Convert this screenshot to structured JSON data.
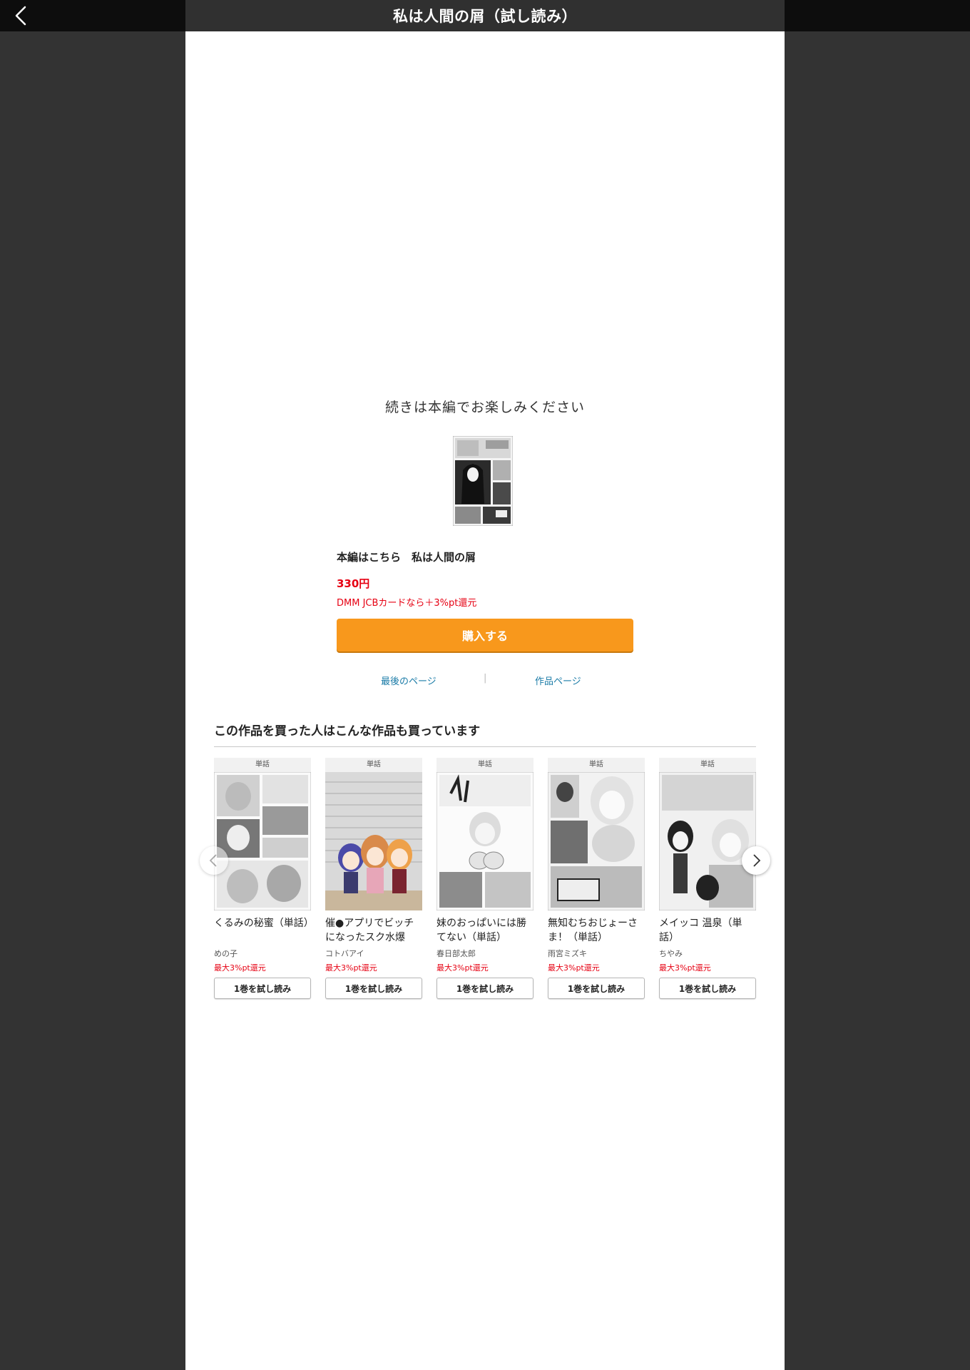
{
  "header": {
    "title": "私は人間の屑（試し読み）",
    "back_icon": "chevron-left-icon"
  },
  "end_screen": {
    "continue_message": "続きは本編でお楽しみください",
    "product_title": "本編はこちら　私は人間の屑",
    "price": "330円",
    "cashback": "DMM JCBカードなら＋3%pt還元",
    "buy_label": "購入する",
    "last_page_link": "最後のページ",
    "work_page_link": "作品ページ",
    "link_separator": "|"
  },
  "recommendations": {
    "heading": "この作品を買った人はこんな作品も買っています",
    "items": [
      {
        "tag": "単話",
        "name": "くるみの秘蜜（単話）",
        "author": "めの子",
        "points": "最大3%pt還元",
        "trial_label": "1巻を試し読み"
      },
      {
        "tag": "単話",
        "name": "催●アプリでビッチになったスク水爆乳…",
        "author": "コトバアイ",
        "points": "最大3%pt還元",
        "trial_label": "1巻を試し読み"
      },
      {
        "tag": "単話",
        "name": "妹のおっぱいには勝てない（単話）",
        "author": "春日部太郎",
        "points": "最大3%pt還元",
        "trial_label": "1巻を試し読み"
      },
      {
        "tag": "単話",
        "name": "無知むちおじょーさま！（単話）",
        "author": "雨宮ミズキ",
        "points": "最大3%pt還元",
        "trial_label": "1巻を試し読み"
      },
      {
        "tag": "単話",
        "name": "メイッコ 温泉（単話）",
        "author": "ちやみ",
        "points": "最大3%pt還元",
        "trial_label": "1巻を試し読み"
      }
    ],
    "prev_icon": "chevron-left-icon",
    "next_icon": "chevron-right-icon"
  },
  "colors": {
    "accent_orange": "#f8981c",
    "price_red": "#e60012",
    "link_blue": "#1a7ba7",
    "backdrop": "#333333"
  }
}
